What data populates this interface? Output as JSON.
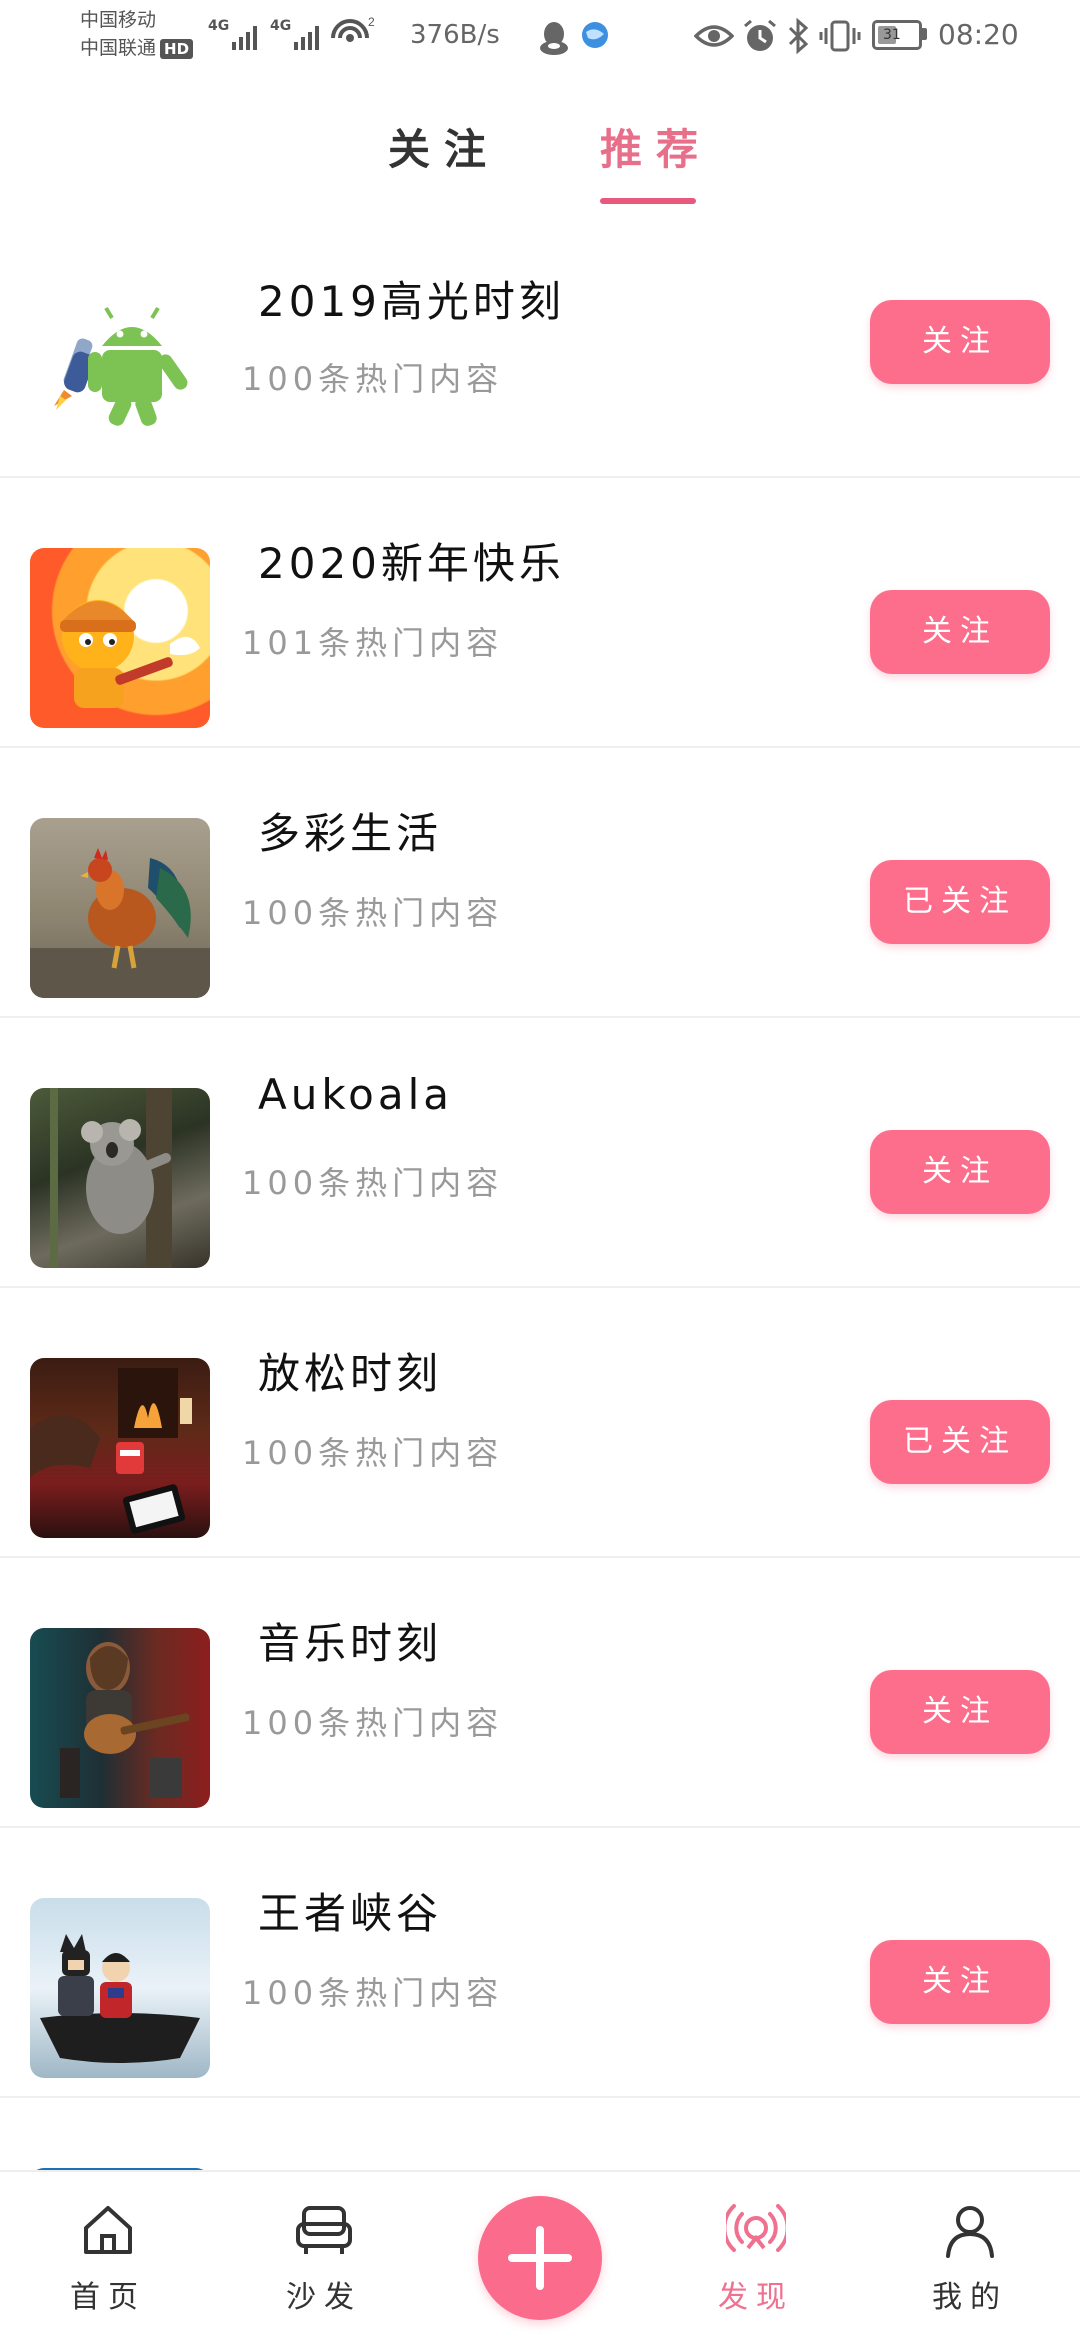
{
  "status_bar": {
    "carrier_1": "中国移动",
    "carrier_2": "中国联通",
    "hd_badge": "HD",
    "signal_1_label": "4G",
    "signal_2_label": "4G",
    "wifi_badge": "2",
    "net_speed": "376B/s",
    "battery_level": "31",
    "time": "08:20",
    "icons": [
      "qq-icon",
      "browser-icon",
      "eye-icon",
      "alarm-icon",
      "bluetooth-icon",
      "vibrate-icon",
      "battery-icon"
    ]
  },
  "tabs": {
    "follow_label": "关注",
    "recommend_label": "推荐",
    "active": "recommend",
    "active_color": "#e86f8a"
  },
  "topics": [
    {
      "title": "2019高光时刻",
      "subtitle": "100条热门内容",
      "button": "关注",
      "followed": false,
      "image": "android-rocket-icon"
    },
    {
      "title": "2020新年快乐",
      "subtitle": "101条热门内容",
      "button": "关注",
      "followed": false,
      "image": "cartoon-firefighter-image"
    },
    {
      "title": "多彩生活",
      "subtitle": "100条热门内容",
      "button": "已关注",
      "followed": true,
      "image": "rooster-image"
    },
    {
      "title": "Aukoala",
      "subtitle": "100条热门内容",
      "button": "关注",
      "followed": false,
      "image": "koala-image"
    },
    {
      "title": "放松时刻",
      "subtitle": "100条热门内容",
      "button": "已关注",
      "followed": true,
      "image": "cozy-fireplace-image"
    },
    {
      "title": "音乐时刻",
      "subtitle": "100条热门内容",
      "button": "关注",
      "followed": false,
      "image": "guitar-player-image"
    },
    {
      "title": "王者峡谷",
      "subtitle": "100条热门内容",
      "button": "关注",
      "followed": false,
      "image": "toy-figures-boat-image"
    },
    {
      "title": "",
      "subtitle": "",
      "button": "",
      "followed": false,
      "image": "blue-screen-image"
    }
  ],
  "bottom_nav": {
    "home_label": "首页",
    "sofa_label": "沙发",
    "add_label": "+",
    "discover_label": "发现",
    "mine_label": "我的",
    "active": "discover"
  },
  "colors": {
    "accent": "#fd6d8c",
    "active_tab": "#e86f8a",
    "subtitle": "#999999"
  }
}
